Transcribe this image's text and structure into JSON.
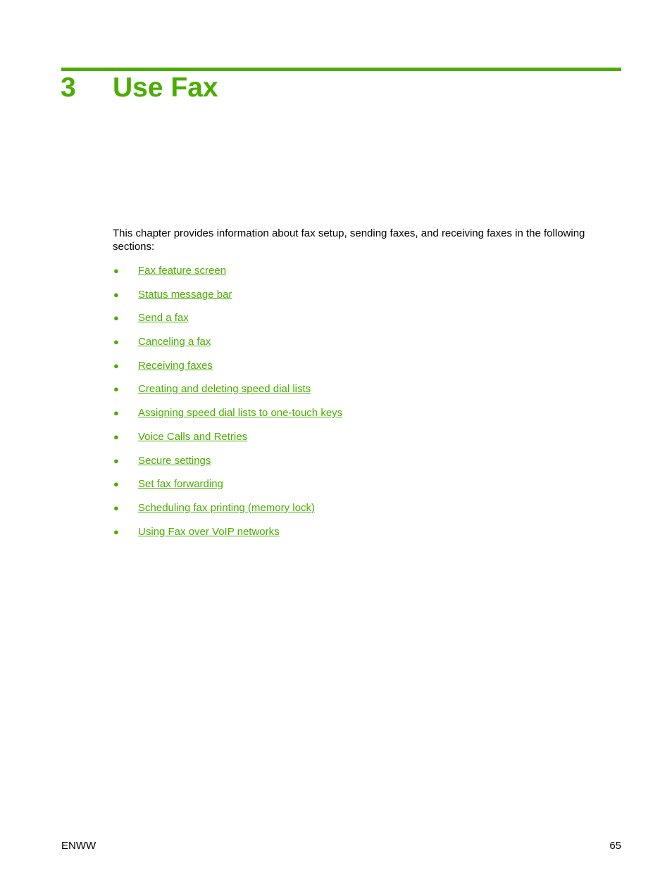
{
  "header": {
    "chapter_number": "3",
    "chapter_title": "Use Fax",
    "accent_color": "#4aad00"
  },
  "intro": "This chapter provides information about fax setup, sending faxes, and receiving faxes in the following sections:",
  "toc": {
    "bullet_icon": "bullet-dot",
    "items": [
      {
        "label": "Fax feature screen"
      },
      {
        "label": "Status message bar"
      },
      {
        "label": "Send a fax"
      },
      {
        "label": "Canceling a fax"
      },
      {
        "label": "Receiving faxes"
      },
      {
        "label": "Creating and deleting speed dial lists"
      },
      {
        "label": "Assigning speed dial lists to one-touch keys"
      },
      {
        "label": "Voice Calls and Retries"
      },
      {
        "label": "Secure settings"
      },
      {
        "label": "Set fax forwarding"
      },
      {
        "label": "Scheduling fax printing (memory lock)"
      },
      {
        "label": "Using Fax over VoIP networks"
      }
    ]
  },
  "footer": {
    "left": "ENWW",
    "page_number": "65"
  }
}
